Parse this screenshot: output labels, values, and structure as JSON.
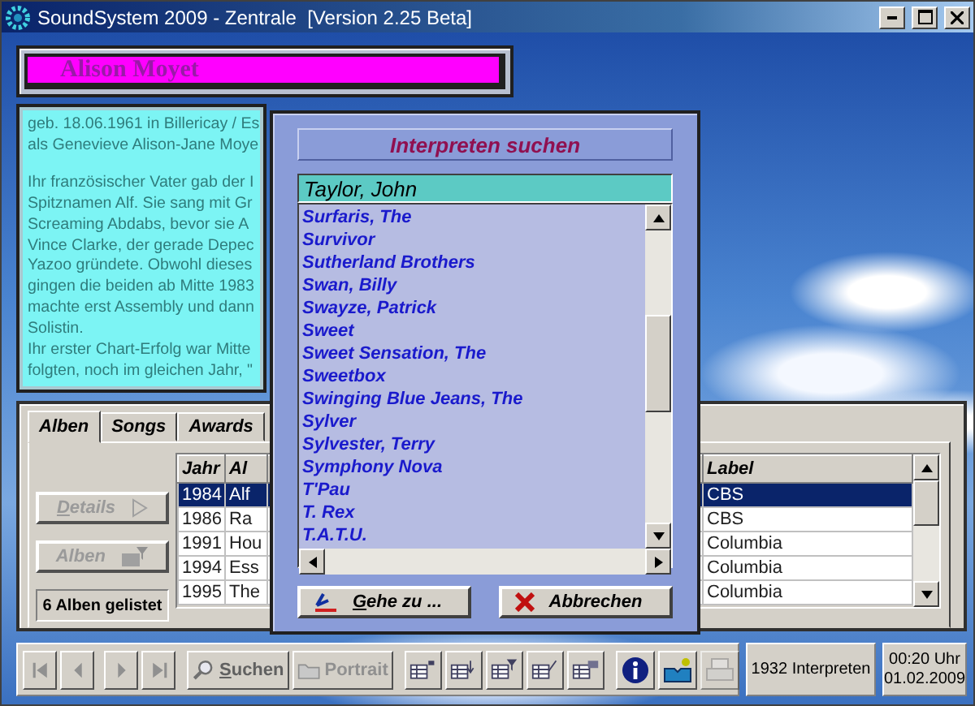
{
  "window": {
    "title": "SoundSystem 2009 - Zentrale  [Version 2.25 Beta]"
  },
  "artist": {
    "name": "Alison Moyet"
  },
  "biography": {
    "paragraphs": [
      [
        "geb. 18.06.1961 in Billericay / Es",
        "als Genevieve Alison-Jane Moye"
      ],
      [
        "Ihr französischer Vater gab der I",
        "Spitznamen Alf. Sie sang mit Gr",
        "Screaming Abdabs, bevor sie A",
        "Vince Clarke, der gerade Depec",
        "Yazoo gründete. Obwohl dieses",
        "gingen die beiden ab Mitte 1983",
        "machte erst Assembly und dann",
        "Solistin.",
        "Ihr erster Chart-Erfolg war Mitte",
        "folgten, noch im gleichen Jahr, \""
      ]
    ]
  },
  "tabs": [
    {
      "label": "Alben",
      "selected": true
    },
    {
      "label": "Songs",
      "selected": false
    },
    {
      "label": "Awards",
      "selected": false
    }
  ],
  "album_buttons": [
    {
      "label": "Details",
      "disabled": true,
      "mnemonic": true
    },
    {
      "label": "Alben",
      "disabled": true,
      "mnemonic": false
    }
  ],
  "album_count": "6 Alben gelistet",
  "table": {
    "columns": [
      "Jahr",
      "Al",
      "Label"
    ],
    "rows": [
      {
        "cells": [
          "1984",
          "Alf",
          "CBS"
        ],
        "selected": true
      },
      {
        "cells": [
          "1986",
          "Ra",
          "CBS"
        ],
        "selected": false
      },
      {
        "cells": [
          "1991",
          "Hou",
          "Columbia"
        ],
        "selected": false
      },
      {
        "cells": [
          "1994",
          "Ess",
          "Columbia"
        ],
        "selected": false
      },
      {
        "cells": [
          "1995",
          "The",
          "Columbia"
        ],
        "selected": false
      }
    ]
  },
  "dialog": {
    "title": "Interpreten suchen",
    "search_value": "Taylor, John",
    "items": [
      "Surfaris, The",
      "Survivor",
      "Sutherland Brothers",
      "Swan, Billy",
      "Swayze, Patrick",
      "Sweet",
      "Sweet Sensation, The",
      "Sweetbox",
      "Swinging Blue Jeans, The",
      "Sylver",
      "Sylvester, Terry",
      "Symphony Nova",
      "T'Pau",
      "T. Rex",
      "T.A.T.U."
    ],
    "buttons": [
      {
        "label": "Gehe zu ...",
        "kind": "go",
        "mnemonic": true
      },
      {
        "label": "Abbrechen",
        "kind": "cancel",
        "mnemonic": false
      }
    ]
  },
  "toolbar": {
    "navigation": [
      {
        "kind": "first",
        "disabled": true
      },
      {
        "kind": "previous",
        "disabled": true
      },
      {
        "kind": "next",
        "disabled": true
      },
      {
        "kind": "last",
        "disabled": true
      }
    ],
    "actions": [
      {
        "label": "Suchen",
        "kind": "search",
        "disabled": false,
        "mnemonic": true
      },
      {
        "label": "Portrait",
        "kind": "portrait",
        "disabled": true,
        "mnemonic": false
      }
    ],
    "tools": [
      {
        "kind": "add",
        "disabled": false
      },
      {
        "kind": "sort",
        "disabled": false
      },
      {
        "kind": "filter",
        "disabled": false
      },
      {
        "kind": "edit",
        "disabled": false
      },
      {
        "kind": "list",
        "disabled": false
      }
    ],
    "extras": [
      {
        "kind": "info",
        "disabled": false
      },
      {
        "kind": "help",
        "disabled": false
      },
      {
        "kind": "print",
        "disabled": true
      }
    ],
    "status": "1932 Interpreten",
    "time": "00:20 Uhr",
    "date": "01.02.2009"
  }
}
